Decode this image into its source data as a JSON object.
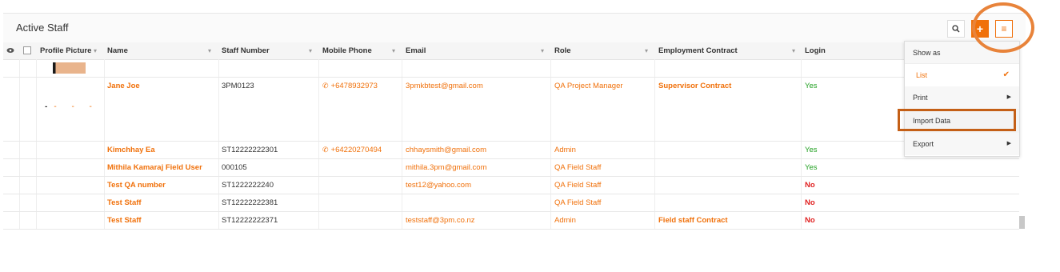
{
  "panel": {
    "title": "Active Staff"
  },
  "toolbar": {
    "add_label": "+",
    "menu_label": "≡"
  },
  "columns": {
    "profile_picture": "Profile Picture",
    "name": "Name",
    "staff_number": "Staff Number",
    "mobile_phone": "Mobile Phone",
    "email": "Email",
    "role": "Role",
    "employment_contract": "Employment Contract",
    "login": "Login"
  },
  "rows": [
    {
      "name": "Jane Joe",
      "staff_number": "3PM0123",
      "mobile": "+6478932973",
      "email": "3pmkbtest@gmail.com",
      "role": "QA Project Manager",
      "contract": "Supervisor Contract",
      "login": "Yes"
    },
    {
      "name": "Kimchhay Ea",
      "staff_number": "ST12222222301",
      "mobile": "+64220270494",
      "email": "chhaysmith@gmail.com",
      "role": "Admin",
      "contract": "",
      "login": "Yes"
    },
    {
      "name": "Mithila Kamaraj Field User",
      "staff_number": "000105",
      "mobile": "",
      "email": "mithila.3pm@gmail.com",
      "role": "QA Field Staff",
      "contract": "",
      "login": "Yes"
    },
    {
      "name": "Test QA number",
      "staff_number": "ST1222222240",
      "mobile": "",
      "email": "test12@yahoo.com",
      "role": "QA Field Staff",
      "contract": "",
      "login": "No"
    },
    {
      "name": "Test Staff",
      "staff_number": "ST12222222381",
      "mobile": "",
      "email": "",
      "role": "QA Field Staff",
      "contract": "",
      "login": "No"
    },
    {
      "name": "Test Staff",
      "staff_number": "ST12222222371",
      "mobile": "",
      "email": "teststaff@3pm.co.nz",
      "role": "Admin",
      "contract": "Field staff Contract",
      "login": "No"
    }
  ],
  "menu": {
    "show_as": "Show as",
    "list": "List",
    "print": "Print",
    "import_data": "Import Data",
    "export": "Export"
  },
  "colors": {
    "accent": "#f0700a",
    "highlight": "#e8833a",
    "yes": "#22a022",
    "no": "#e02020"
  }
}
